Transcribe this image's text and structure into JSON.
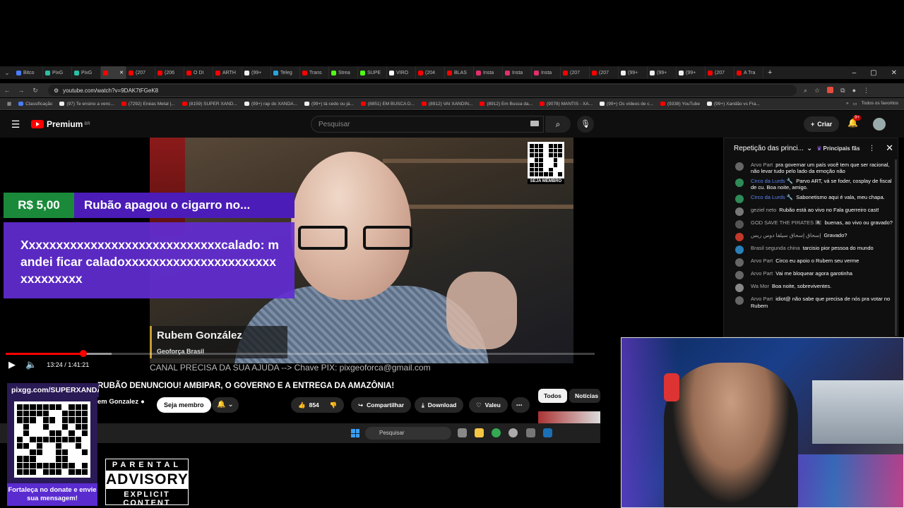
{
  "browser": {
    "tabs": [
      {
        "label": "Bitco",
        "color": "#4a7cff"
      },
      {
        "label": "PixG",
        "color": "#2bbfa5"
      },
      {
        "label": "PixG",
        "color": "#2bbfa5"
      },
      {
        "label": "",
        "color": "#ff0000",
        "active": true
      },
      {
        "label": "(207",
        "color": "#ff0000"
      },
      {
        "label": "(206",
        "color": "#ff0000"
      },
      {
        "label": "O DI",
        "color": "#ff0000"
      },
      {
        "label": "ARTH",
        "color": "#ff0000"
      },
      {
        "label": "(99+",
        "color": "#eeeeee"
      },
      {
        "label": "Teleg",
        "color": "#2aa3e0"
      },
      {
        "label": "Trans",
        "color": "#ff0000"
      },
      {
        "label": "Strea",
        "color": "#53fc18"
      },
      {
        "label": "SUPE",
        "color": "#53fc18"
      },
      {
        "label": "VIRO",
        "color": "#ffffff"
      },
      {
        "label": "(204",
        "color": "#ff0000"
      },
      {
        "label": "BLAS",
        "color": "#ff0000"
      },
      {
        "label": "Insta",
        "color": "#e1306c"
      },
      {
        "label": "Insta",
        "color": "#e1306c"
      },
      {
        "label": "Insta",
        "color": "#e1306c"
      },
      {
        "label": "(207",
        "color": "#ff0000"
      },
      {
        "label": "(207",
        "color": "#ff0000"
      },
      {
        "label": "(99+",
        "color": "#eeeeee"
      },
      {
        "label": "(99+",
        "color": "#eeeeee"
      },
      {
        "label": "(99+",
        "color": "#eeeeee"
      },
      {
        "label": "(207",
        "color": "#ff0000"
      },
      {
        "label": "A Tra",
        "color": "#ff0000"
      }
    ],
    "new_tab": "+",
    "url": "youtube.com/watch?v=9DAK7tFGeK8",
    "bookmarks": [
      {
        "label": "Classificação",
        "color": "#4a7cff"
      },
      {
        "label": "(97) Te ensino a venc...",
        "color": "#eeeeee"
      },
      {
        "label": "(7292) Enéas Metal |...",
        "color": "#ff0000"
      },
      {
        "label": "(8159) SUPER XAND...",
        "color": "#ff0000"
      },
      {
        "label": "(99+) rap do XANDÃ...",
        "color": "#eeeeee"
      },
      {
        "label": "(99+) tá cedo ou já...",
        "color": "#eeeeee"
      },
      {
        "label": "(8851) EM BUSCA D...",
        "color": "#ff0000"
      },
      {
        "label": "(8912) VAI XANDIN...",
        "color": "#ff0000"
      },
      {
        "label": "(8912) Em Busca da...",
        "color": "#ff0000"
      },
      {
        "label": "(9078) MANTIS - XA...",
        "color": "#ff0000"
      },
      {
        "label": "(99+) Os vídeos de c...",
        "color": "#eeeeee"
      },
      {
        "label": "(9338) YouTube",
        "color": "#ff0000"
      },
      {
        "label": "(99+) Xandão vs Fra...",
        "color": "#eeeeee"
      }
    ],
    "all_bookmarks": "Todos os favoritos"
  },
  "youtube": {
    "logo": "Premium",
    "region": "BR",
    "search_placeholder": "Pesquisar",
    "create_label": "Criar",
    "notif_badge": "9+"
  },
  "video": {
    "superchat_amount": "R$ 5,00",
    "superchat_title": "Rubão apagou o cigarro no...",
    "superchat_body": "Xxxxxxxxxxxxxxxxxxxxxxxxxxxxxcalado: mandei ficar caladoxxxxxxxxxxxxxxxxxxxxxxxxxxxxxxx",
    "qr_label": "SEJA MEMBRO",
    "lower_third_name": "Rubem González",
    "lower_third_sub": "Geoforça Brasil",
    "pix_banner": "CANAL PRECISA DA SUA AJUDA --> Chave PIX: pixgeoforca@gmail.com",
    "time": "13:24 / 1:41:21",
    "progress_played": 0.132,
    "progress_loaded": 0.18,
    "title": "RUBÃO DENUNCIOU! AMBIPAR, O GOVERNO E A ENTREGA DA AMAZÔNIA!",
    "channel": "em Gonzalez",
    "member_button": "Seja membro",
    "likes": "854",
    "share": "Compartilhar",
    "download": "Download",
    "thanks": "Valeu",
    "chip_all": "Todos",
    "chip_news": "Notícias r"
  },
  "taskbar": {
    "search": "Pesquisar"
  },
  "chat": {
    "header": "Repetição das princi...",
    "filter": "Principais fãs",
    "messages": [
      {
        "author": "Arvo Part",
        "text": "pra governar um país você tem que ser racional, não levar tudo pelo lado da emoção não",
        "mod": false,
        "color": "#666666"
      },
      {
        "author": "Circo da Lurds 🔧",
        "text": "Parvo ART, vá se foder, cosplay de fiscal de cu. Boa noite, amigo.",
        "mod": true,
        "color": "#2e8b57"
      },
      {
        "author": "Circo da Lurds 🔧",
        "text": "Sabonetismo aqui é vala, meu chapa.",
        "mod": true,
        "color": "#2e8b57"
      },
      {
        "author": "geziel neto",
        "text": "Rubão está ao vivo no Fala guerreiro cast!",
        "mod": false,
        "color": "#777777"
      },
      {
        "author": "GOD SAVE THE PIRATES 🏴‍☠️",
        "text": "buenas, ao vivo ou gravado?",
        "mod": false,
        "color": "#555555"
      },
      {
        "author": "إسحاق إسحاق سيلفا دوس ريس",
        "text": "Gravado?",
        "mod": false,
        "color": "#c0392b"
      },
      {
        "author": "Brasil segunda china",
        "text": "tarcisio pior pessoa do mundo",
        "mod": false,
        "color": "#2980b9"
      },
      {
        "author": "Arvo Part",
        "text": "Circo eu apoio o Rubem seu verme",
        "mod": false,
        "color": "#666666"
      },
      {
        "author": "Arvo Part",
        "text": "Vai me bloquear agora garotinha",
        "mod": false,
        "color": "#666666"
      },
      {
        "author": "Wa Mor",
        "text": "Boa noite, sobreviventes.",
        "mod": false,
        "color": "#888888"
      },
      {
        "author": "Arvo Part",
        "text": "idiot@ não sabe que precisa de nós pra votar no Rubem",
        "mod": false,
        "color": "#666666"
      }
    ]
  },
  "overlay": {
    "pix_url": "pixgg.com/SUPERXANDÃO",
    "donate_text": "Fortaleça no donate e envie sua mensagem!",
    "advisory_top": "PARENTAL",
    "advisory_main": "ADVISORY",
    "advisory_bottom": "EXPLICIT CONTENT"
  }
}
